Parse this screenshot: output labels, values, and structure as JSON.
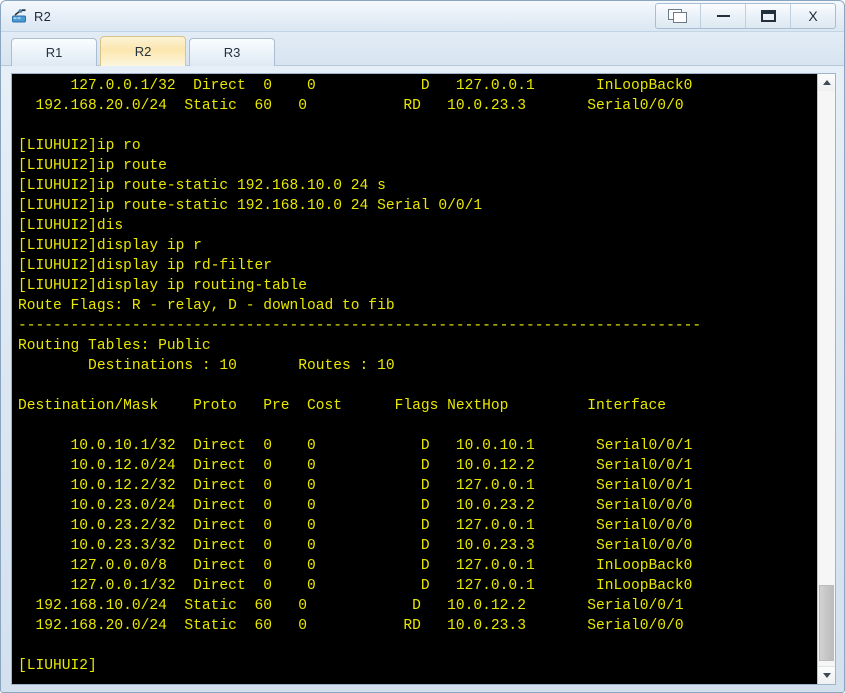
{
  "window": {
    "title": "R2",
    "icon": "router-icon",
    "controls": [
      {
        "name": "cascade-windows-button",
        "icon": "cascade-icon",
        "label": ""
      },
      {
        "name": "minimize-button",
        "icon": "minimize-icon",
        "label": ""
      },
      {
        "name": "maximize-button",
        "icon": "maximize-icon",
        "label": ""
      },
      {
        "name": "close-button",
        "icon": "close-icon",
        "label": "X"
      }
    ]
  },
  "tabs": [
    {
      "label": "R1",
      "active": false
    },
    {
      "label": "R2",
      "active": true
    },
    {
      "label": "R3",
      "active": false
    }
  ],
  "terminal": {
    "prompt": "[LIUHUI2]",
    "foreground_color": "#e8e800",
    "background_color": "#000000",
    "scrollbar": {
      "up_arrow": "▲",
      "down_arrow": "▼",
      "thumb_position": "bottom"
    },
    "text": "      127.0.0.1/32  Direct  0    0            D   127.0.0.1       InLoopBack0\n  192.168.20.0/24  Static  60   0           RD   10.0.23.3       Serial0/0/0\n\n[LIUHUI2]ip ro\n[LIUHUI2]ip route\n[LIUHUI2]ip route-static 192.168.10.0 24 s\n[LIUHUI2]ip route-static 192.168.10.0 24 Serial 0/0/1\n[LIUHUI2]dis\n[LIUHUI2]display ip r\n[LIUHUI2]display ip rd-filter\n[LIUHUI2]display ip routing-table\nRoute Flags: R - relay, D - download to fib\n------------------------------------------------------------------------------\nRouting Tables: Public\n        Destinations : 10       Routes : 10\n\nDestination/Mask    Proto   Pre  Cost      Flags NextHop         Interface\n\n      10.0.10.1/32  Direct  0    0            D   10.0.10.1       Serial0/0/1\n      10.0.12.0/24  Direct  0    0            D   10.0.12.2       Serial0/0/1\n      10.0.12.2/32  Direct  0    0            D   127.0.0.1       Serial0/0/1\n      10.0.23.0/24  Direct  0    0            D   10.0.23.2       Serial0/0/0\n      10.0.23.2/32  Direct  0    0            D   127.0.0.1       Serial0/0/0\n      10.0.23.3/32  Direct  0    0            D   10.0.23.3       Serial0/0/0\n      127.0.0.0/8   Direct  0    0            D   127.0.0.1       InLoopBack0\n      127.0.0.1/32  Direct  0    0            D   127.0.0.1       InLoopBack0\n  192.168.10.0/24  Static  60   0            D   10.0.12.2       Serial0/0/1\n  192.168.20.0/24  Static  60   0           RD   10.0.23.3       Serial0/0/0\n\n[LIUHUI2]"
  }
}
